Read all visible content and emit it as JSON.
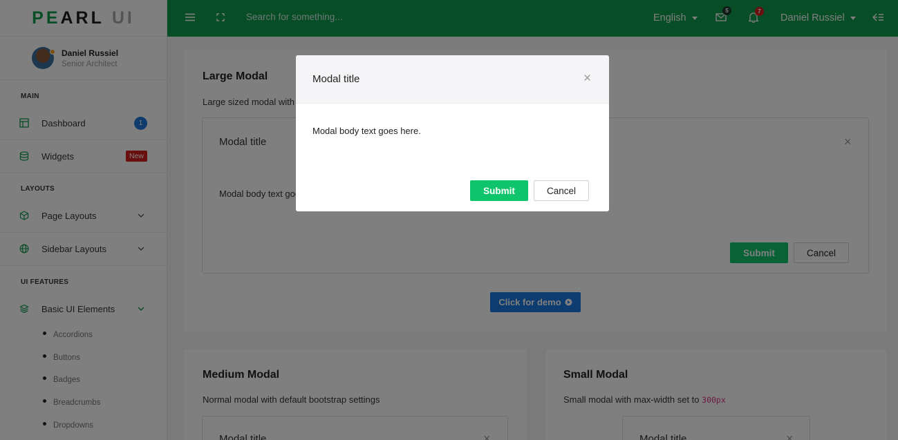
{
  "brand": {
    "part1": "PE",
    "part2": "ARL",
    "part3": "UI"
  },
  "profile": {
    "name": "Daniel Russiel",
    "role": "Senior Architect"
  },
  "sidebar": {
    "sections": [
      "MAIN",
      "LAYOUTS",
      "UI FEATURES"
    ],
    "items": [
      {
        "label": "Dashboard",
        "badge": "1"
      },
      {
        "label": "Widgets",
        "badge": "New"
      },
      {
        "label": "Page Layouts"
      },
      {
        "label": "Sidebar Layouts"
      },
      {
        "label": "Basic UI Elements"
      }
    ],
    "subitems": [
      "Accordions",
      "Buttons",
      "Badges",
      "Breadcrumbs",
      "Dropdowns"
    ]
  },
  "topbar": {
    "search_placeholder": "Search for something...",
    "language": "English",
    "mail_count": "5",
    "notif_count": "7",
    "user": "Daniel Russiel"
  },
  "cards": {
    "large": {
      "title": "Large Modal",
      "desc": "Large sized modal with",
      "modal_title": "Modal title",
      "modal_body": "Modal body text goes here.",
      "submit": "Submit",
      "cancel": "Cancel",
      "demo": "Click for demo"
    },
    "medium": {
      "title": "Medium Modal",
      "desc": "Normal modal with default bootstrap settings",
      "modal_title": "Modal title"
    },
    "small": {
      "title": "Small Modal",
      "desc": "Small modal with max-width set to",
      "code": "300px",
      "modal_title": "Modal title"
    }
  },
  "modal": {
    "title": "Modal title",
    "close": "×",
    "body": "Modal body text goes here.",
    "submit": "Submit",
    "cancel": "Cancel"
  },
  "colors": {
    "brand_green": "#0f9a4c",
    "submit_green": "#0fc56b",
    "primary_blue": "#1a78e0",
    "badge_red": "#d41f1f"
  }
}
